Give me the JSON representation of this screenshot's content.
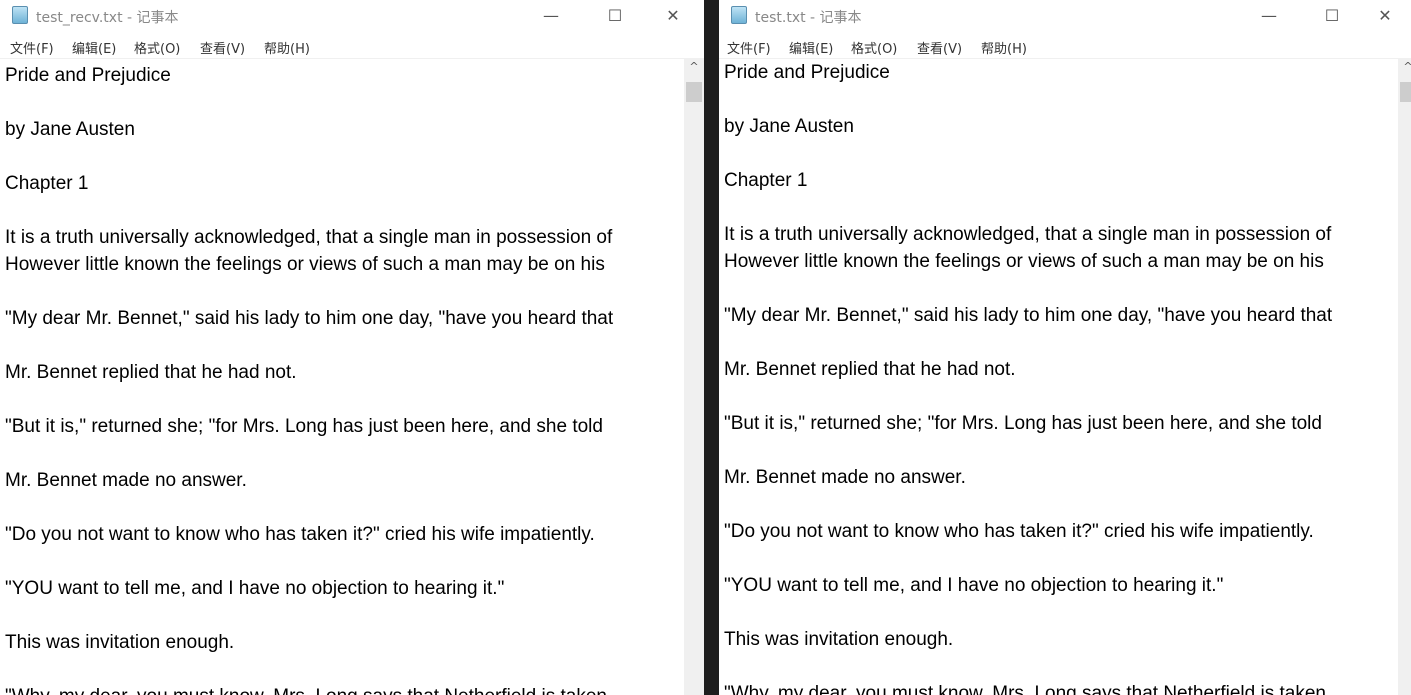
{
  "windows": [
    {
      "title": "test_recv.txt - 记事本"
    },
    {
      "title": "test.txt - 记事本"
    }
  ],
  "menu": [
    "文件(F)",
    "编辑(E)",
    "格式(O)",
    "查看(V)",
    "帮助(H)"
  ],
  "controls": {
    "minimize": "—",
    "maximize": "☐",
    "close": "✕"
  },
  "scroll_up": "^",
  "lines": [
    "Pride and Prejudice",
    "",
    "by Jane Austen",
    "",
    "Chapter 1",
    "",
    "It is a truth universally acknowledged, that a single man in possession of",
    "However little known the feelings or views of such a man may be on his",
    "",
    "\"My dear Mr. Bennet,\" said his lady to him one day, \"have you heard that",
    "",
    "Mr. Bennet replied that he had not.",
    "",
    "\"But it is,\" returned she; \"for Mrs. Long has just been here, and she told",
    "",
    "Mr. Bennet made no answer.",
    "",
    "\"Do you not want to know who has taken it?\" cried his wife impatiently.",
    "",
    "\"YOU want to tell me, and I have no objection to hearing it.\"",
    "",
    "This was invitation enough.",
    "",
    "\"Why, my dear, you must know, Mrs. Long says that Netherfield is taken"
  ]
}
